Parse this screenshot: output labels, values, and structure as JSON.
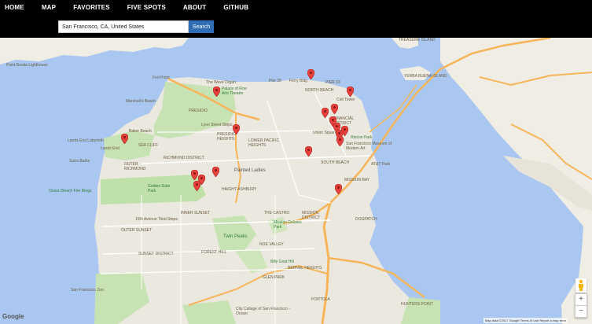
{
  "nav": {
    "items": [
      {
        "label": "HOME"
      },
      {
        "label": "MAP"
      },
      {
        "label": "FAVORITES"
      },
      {
        "label": "FIVE SPOTS"
      },
      {
        "label": "ABOUT"
      },
      {
        "label": "GITHUB"
      }
    ]
  },
  "search": {
    "value": "San Francisco, CA, United States",
    "button_label": "Search"
  },
  "map": {
    "labels": {
      "treasure_island": "TREASURE ISLAND",
      "yerba_buena": "YERBA BUENA ISLAND",
      "point_bonita": "Point Bonita Lighthouse",
      "fort_point": "Fort Point",
      "wave_organ": "The Wave Organ",
      "pier39": "Pier 39",
      "ferry_bldg": "Ferry Bldg",
      "pier33": "PIER 33",
      "palace": "Palace of Fine Arts Theatre",
      "marshalls": "Marshall's Beach",
      "north_beach": "NORTH BEACH",
      "coit": "Coit Tower",
      "presidio": "PRESIDIO",
      "lyon_steps": "Lyon Street Steps",
      "financial": "FINANCIAL DISTRICT",
      "baker_beach": "Baker Beach",
      "presidio_heights": "PRESIDIO HEIGHTS",
      "lower_pac": "LOWER PACIFIC HEIGHTS",
      "union_sq": "Union Square",
      "rincon": "Rincon Park",
      "sfmoma": "San Francisco Museum of Modern Art",
      "lands_end_lab": "Lands End Labyrinth",
      "lands_end": "Lands End",
      "sea_cliff": "SEA CLIFF",
      "sutro": "Sutro Baths",
      "richmond": "RICHMOND DISTRICT",
      "outer_richmond": "OUTER RICHMOND",
      "painted_ladies": "Painted Ladies",
      "south_beach": "SOUTH BEACH",
      "att": "AT&T Park",
      "ocean_beach": "Ocean Beach Fire Rings",
      "golden_gate": "Golden Gate Park",
      "haight": "HAIGHT-ASHBURY",
      "mission_bay": "MISSION BAY",
      "inner_sunset": "INNER SUNSET",
      "castro": "THE CASTRO",
      "mission_district": "MISSION DISTRICT",
      "avenue_steps": "16th Avenue Tiled Steps",
      "mission_dolores": "Mission Dolores Park",
      "dogpatch": "DOGPATCH",
      "outer_sunset": "OUTER SUNSET",
      "twin_peaks": "Twin Peaks",
      "sunset": "SUNSET DISTRICT",
      "forest_hill": "FOREST HILL",
      "noe_valley": "NOE VALLEY",
      "bernal": "BERNAL HEIGHTS",
      "glen_park": "GLEN PARK",
      "billy_goat": "Billy Goat Hill",
      "sf_zoo": "San Francisco Zoo",
      "portola": "PORTOLA",
      "hunters": "HUNTERS POINT",
      "ccsf": "City College of San Francisco - Ocean"
    },
    "google_logo": "Google",
    "attribution": "Map data ©2017 Google   Terms of Use   Report a map error",
    "zoom_in": "+",
    "zoom_out": "−"
  }
}
